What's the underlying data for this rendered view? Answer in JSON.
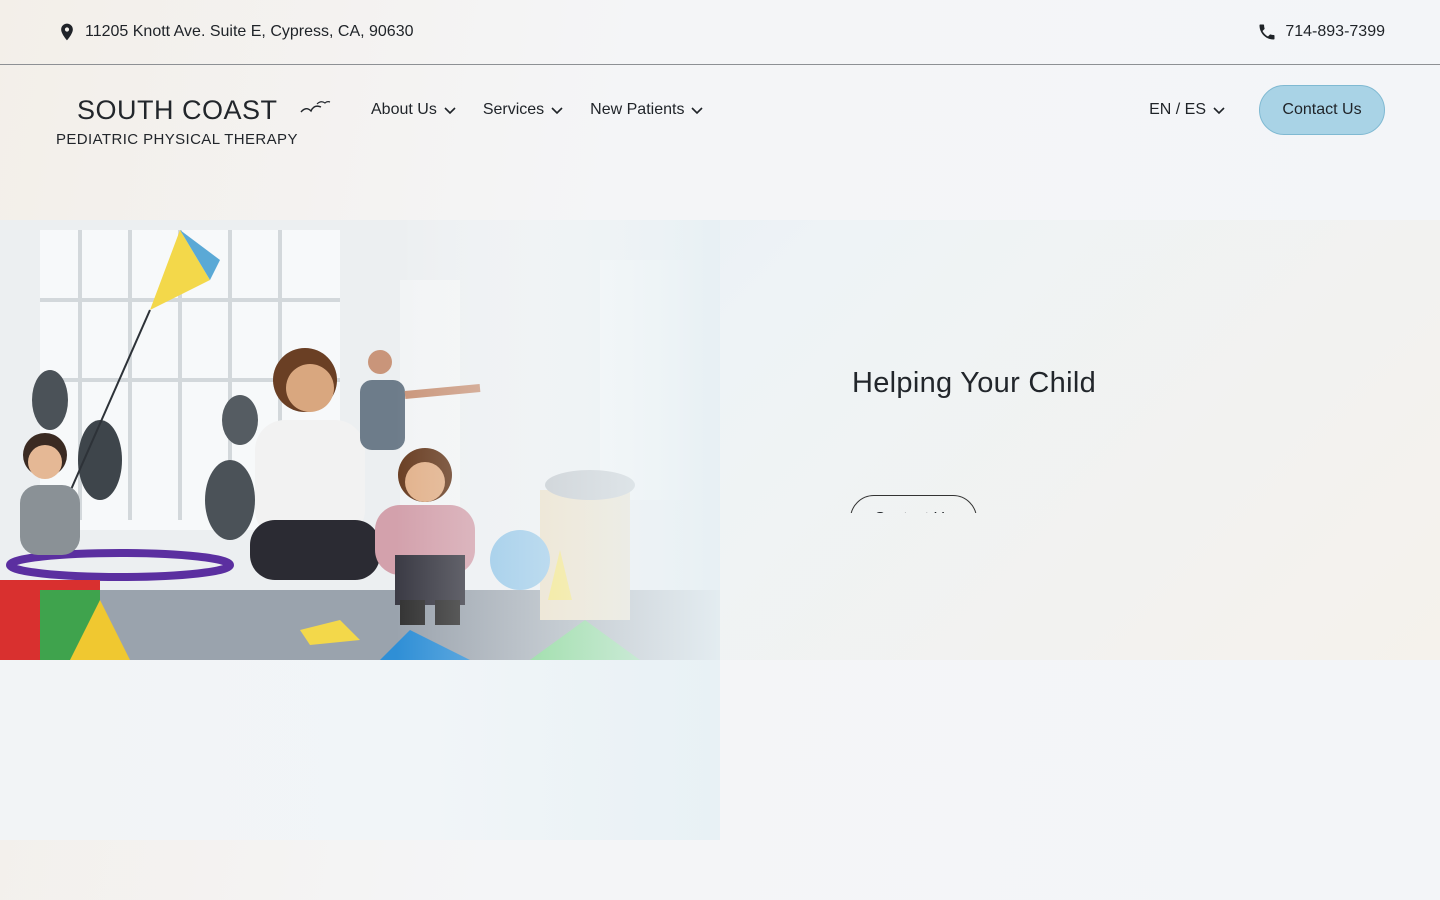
{
  "topbar": {
    "address": "11205 Knott Ave. Suite E, Cypress, CA, 90630",
    "address_icon": "location-pin-icon",
    "phone": "714-893-7399",
    "phone_icon": "phone-icon"
  },
  "logo": {
    "line1": "SOUTH COAST",
    "line2": "PEDIATRIC PHYSICAL THERAPY",
    "icon": "seagull-icon"
  },
  "nav": {
    "items": [
      {
        "label": "About Us"
      },
      {
        "label": "Services"
      },
      {
        "label": "New Patients"
      }
    ],
    "language_label": "EN / ES",
    "contact_label": "Contact Us"
  },
  "hero": {
    "title": "Helping Your Child",
    "button_label": "Contact Us",
    "image_description_icon": "hero-photo"
  },
  "colors": {
    "accent": "#a9d3e6",
    "accent_border": "#7fb9d2",
    "text": "#1f2328"
  }
}
